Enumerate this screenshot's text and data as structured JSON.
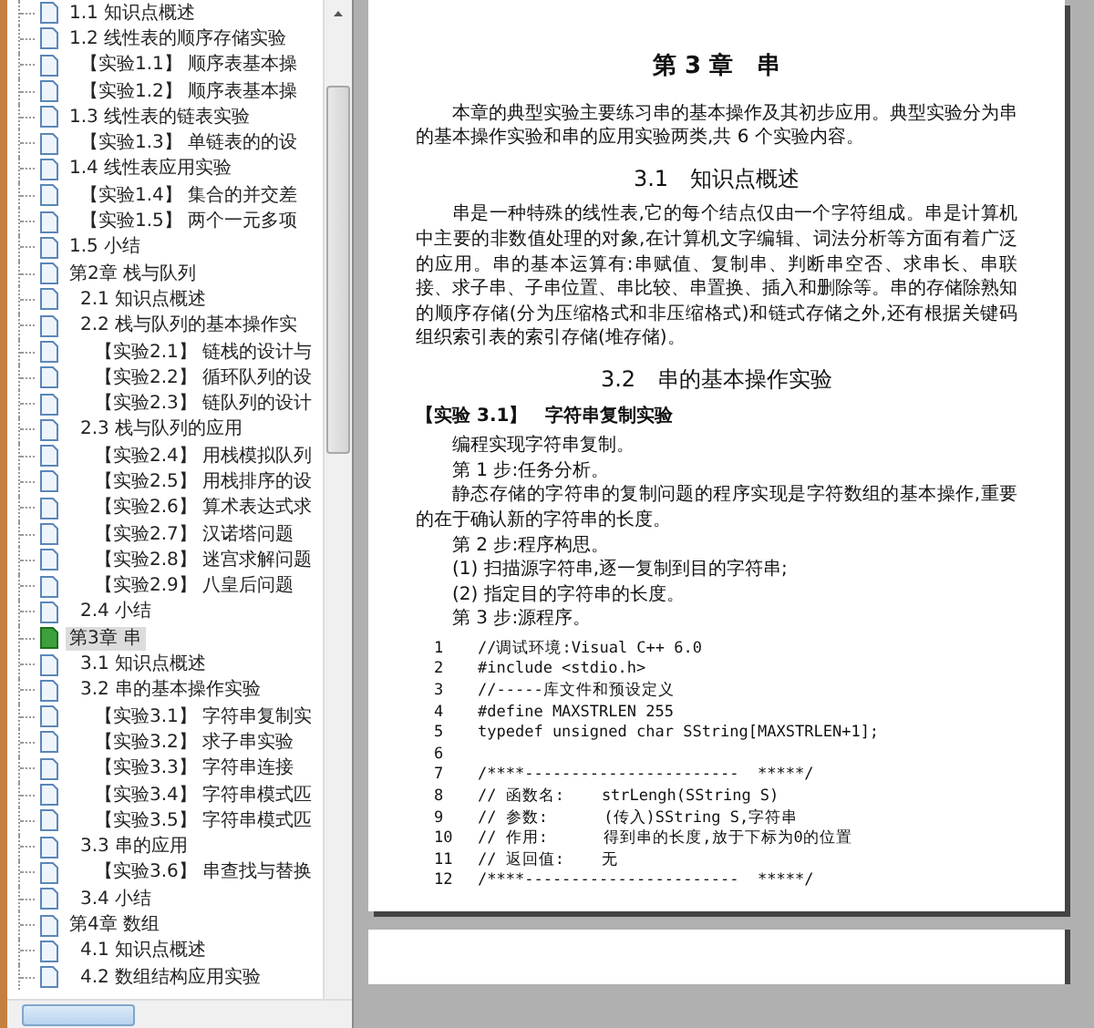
{
  "bookmarks": [
    {
      "label": "1.1 知识点概述",
      "selected": false
    },
    {
      "label": "1.2 线性表的顺序存储实验",
      "selected": false,
      "children": [
        {
          "label": "【实验1.1】 顺序表基本操",
          "selected": false
        },
        {
          "label": "【实验1.2】 顺序表基本操",
          "selected": false
        }
      ]
    },
    {
      "label": "1.3 线性表的链表实验",
      "selected": false,
      "children": [
        {
          "label": "【实验1.3】 单链表的的设",
          "selected": false
        }
      ]
    },
    {
      "label": "1.4 线性表应用实验",
      "selected": false,
      "children": [
        {
          "label": "【实验1.4】 集合的并交差",
          "selected": false
        },
        {
          "label": "【实验1.5】 两个一元多项",
          "selected": false
        }
      ]
    },
    {
      "label": "1.5 小结",
      "selected": false
    },
    {
      "label": "第2章 栈与队列",
      "selected": false,
      "children": [
        {
          "label": "2.1 知识点概述",
          "selected": false
        },
        {
          "label": "2.2 栈与队列的基本操作实",
          "selected": false,
          "children": [
            {
              "label": "【实验2.1】 链栈的设计与",
              "selected": false
            },
            {
              "label": "【实验2.2】 循环队列的设",
              "selected": false
            },
            {
              "label": "【实验2.3】 链队列的设计",
              "selected": false
            }
          ]
        },
        {
          "label": "2.3 栈与队列的应用",
          "selected": false,
          "children": [
            {
              "label": "【实验2.4】 用栈模拟队列",
              "selected": false
            },
            {
              "label": "【实验2.5】 用栈排序的设",
              "selected": false
            },
            {
              "label": "【实验2.6】 算术表达式求",
              "selected": false
            },
            {
              "label": "【实验2.7】 汉诺塔问题",
              "selected": false
            },
            {
              "label": "【实验2.8】 迷宫求解问题",
              "selected": false
            },
            {
              "label": "【实验2.9】 八皇后问题",
              "selected": false
            }
          ]
        },
        {
          "label": "2.4 小结",
          "selected": false
        }
      ]
    },
    {
      "label": "第3章 串",
      "selected": true,
      "children": [
        {
          "label": "3.1 知识点概述",
          "selected": false
        },
        {
          "label": "3.2 串的基本操作实验",
          "selected": false,
          "children": [
            {
              "label": "【实验3.1】 字符串复制实",
              "selected": false
            },
            {
              "label": "【实验3.2】 求子串实验",
              "selected": false
            },
            {
              "label": "【实验3.3】 字符串连接",
              "selected": false
            },
            {
              "label": "【实验3.4】 字符串模式匹",
              "selected": false
            },
            {
              "label": "【实验3.5】 字符串模式匹",
              "selected": false
            }
          ]
        },
        {
          "label": "3.3 串的应用",
          "selected": false,
          "children": [
            {
              "label": "【实验3.6】 串查找与替换",
              "selected": false
            }
          ]
        },
        {
          "label": "3.4 小结",
          "selected": false
        }
      ]
    },
    {
      "label": "第4章 数组",
      "selected": false,
      "children": [
        {
          "label": "4.1 知识点概述",
          "selected": false
        },
        {
          "label": "4.2 数组结构应用实验",
          "selected": false
        }
      ]
    }
  ],
  "page": {
    "chapter_title": "第 3 章　串",
    "intro": "本章的典型实验主要练习串的基本操作及其初步应用。典型实验分为串的基本操作实验和串的应用实验两类,共 6 个实验内容。",
    "sections": [
      {
        "heading": "3.1　知识点概述",
        "paragraphs": [
          "串是一种特殊的线性表,它的每个结点仅由一个字符组成。串是计算机中主要的非数值处理的对象,在计算机文字编辑、词法分析等方面有着广泛的应用。串的基本运算有:串赋值、复制串、判断串空否、求串长、串联接、求子串、子串位置、串比较、串置换、插入和删除等。串的存储除熟知的顺序存储(分为压缩格式和非压缩格式)和链式存储之外,还有根据关键码组织索引表的索引存储(堆存储)。"
        ]
      },
      {
        "heading": "3.2　串的基本操作实验",
        "experiment": "【实验 3.1】　字符串复制实验",
        "paragraphs": [
          "编程实现字符串复制。",
          "第 1 步:任务分析。",
          "静态存储的字符串的复制问题的程序实现是字符数组的基本操作,重要的在于确认新的字符串的长度。",
          "第 2 步:程序构思。",
          "(1) 扫描源字符串,逐一复制到目的字符串;",
          "(2) 指定目的字符串的长度。",
          "第 3 步:源程序。"
        ],
        "code": [
          {
            "number": "1",
            "code": "//调试环境:Visual C++ 6.0"
          },
          {
            "number": "2",
            "code": "#include <stdio.h>"
          },
          {
            "number": "3",
            "code": "//-----库文件和预设定义"
          },
          {
            "number": "4",
            "code": "#define MAXSTRLEN 255"
          },
          {
            "number": "5",
            "code": "typedef unsigned char SString[MAXSTRLEN+1];"
          },
          {
            "number": "6"
          },
          {
            "number": "7",
            "code": "/****-----------------------  *****/"
          },
          {
            "number": "8",
            "code": "// 函数名:    strLengh(SString S)"
          },
          {
            "number": "9",
            "code": "// 参数:      (传入)SString S,字符串"
          },
          {
            "number": "10",
            "code": "// 作用:      得到串的长度,放于下标为0的位置"
          },
          {
            "number": "11",
            "code": "// 返回值:    无"
          },
          {
            "number": "12",
            "code": "/****-----------------------  *****/"
          }
        ]
      }
    ]
  }
}
